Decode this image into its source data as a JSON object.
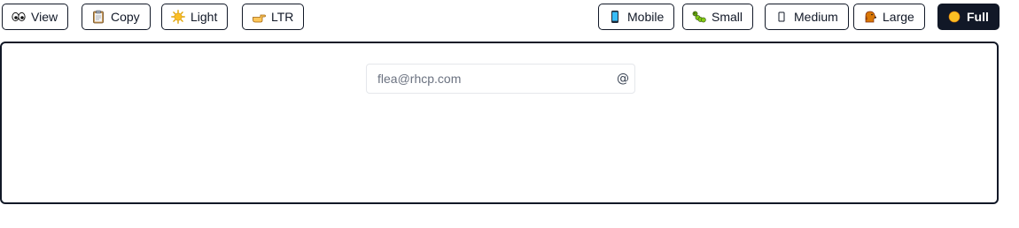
{
  "toolbar": {
    "left": [
      {
        "label": "View",
        "icon": "eyes-icon"
      },
      {
        "label": "Copy",
        "icon": "clipboard-icon"
      },
      {
        "label": "Light",
        "icon": "sun-icon"
      },
      {
        "label": "LTR",
        "icon": "pointing-hand-icon"
      }
    ],
    "right": [
      {
        "label": "Mobile",
        "icon": "phone-icon"
      },
      {
        "label": "Small",
        "icon": "caterpillar-icon"
      },
      {
        "label": "Medium",
        "icon": "rectangle-icon"
      },
      {
        "label": "Large",
        "icon": "dog-icon"
      },
      {
        "label": "Full",
        "icon": "circle-icon",
        "active": true
      }
    ]
  },
  "email_input": {
    "placeholder": "flea@rhcp.com",
    "value": "",
    "suffix": "@"
  },
  "colors": {
    "dark": "#111827",
    "border_light": "#e5e7eb",
    "placeholder": "#6b7280"
  }
}
